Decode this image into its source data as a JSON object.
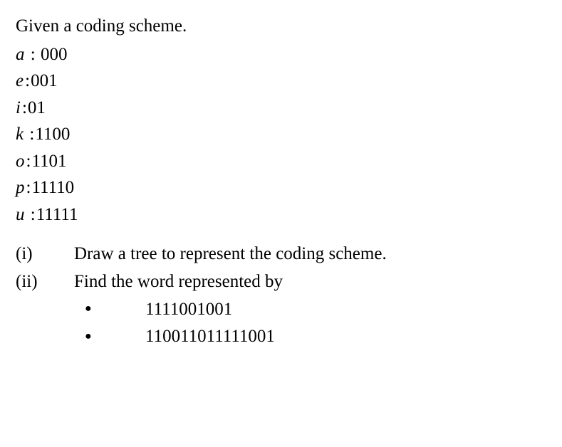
{
  "intro": "Given a coding scheme.",
  "codes": [
    {
      "symbol": "a",
      "sep": " : ",
      "bits": "000"
    },
    {
      "symbol": "e",
      "sep": ":",
      "bits": "001"
    },
    {
      "symbol": "i",
      "sep": ":",
      "bits": "01"
    },
    {
      "symbol": "k",
      "sep": " :",
      "bits": "1100"
    },
    {
      "symbol": "o",
      "sep": ":",
      "bits": "1101"
    },
    {
      "symbol": "p",
      "sep": ":",
      "bits": "11110"
    },
    {
      "symbol": "u",
      "sep": " :",
      "bits": "11111"
    }
  ],
  "parts": {
    "i": {
      "label": "(i)",
      "text": "Draw a tree to represent the coding scheme."
    },
    "ii": {
      "label": "(ii)",
      "text": "Find the word represented by"
    }
  },
  "bullets": [
    "1111001001",
    "110011011111001"
  ]
}
